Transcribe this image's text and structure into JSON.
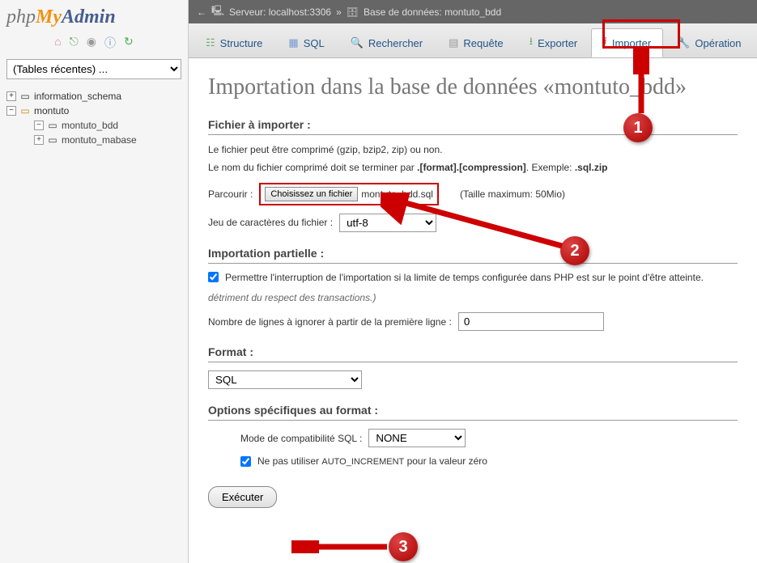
{
  "logo": {
    "php": "php",
    "my": "My",
    "admin": "Admin"
  },
  "sidebar": {
    "recent_label": "(Tables récentes) ...",
    "tree": [
      {
        "label": "information_schema",
        "toggle": "+"
      },
      {
        "label": "montuto",
        "toggle": "−"
      },
      {
        "label": "montuto_bdd",
        "toggle": "−",
        "selected": true
      },
      {
        "label": "montuto_mabase",
        "toggle": "+"
      }
    ]
  },
  "breadcrumb": {
    "server_label": "Serveur: localhost:3306",
    "db_label": "Base de données: montuto_bdd",
    "sep": "»"
  },
  "tabs": [
    {
      "label": "Structure"
    },
    {
      "label": "SQL"
    },
    {
      "label": "Rechercher"
    },
    {
      "label": "Requête"
    },
    {
      "label": "Exporter"
    },
    {
      "label": "Importer",
      "active": true
    },
    {
      "label": "Opération"
    }
  ],
  "page": {
    "title": "Importation dans la base de données «montuto_bdd»",
    "section_file": "Fichier à importer :",
    "hint1": "Le fichier peut être comprimé (gzip, bzip2, zip) ou non.",
    "hint2a": "Le nom du fichier comprimé doit se terminer par ",
    "hint2b": ".[format].[compression]",
    "hint2c": ". Exemple: ",
    "hint2d": ".sql.zip",
    "browse_label": "Parcourir :",
    "choose_btn": "Choisissez un fichier",
    "chosen_file": "montuto_bdd.sql",
    "max_size": "(Taille maximum: 50Mio)",
    "charset_label": "Jeu de caractères du fichier :",
    "charset_value": "utf-8",
    "section_partial": "Importation partielle :",
    "partial_check": "Permettre l'interruption de l'importation si la limite de temps configurée dans PHP est sur le point d'être atteinte.",
    "partial_note": "détriment du respect des transactions.)",
    "skip_label": "Nombre de lignes à ignorer à partir de la première ligne :",
    "skip_value": "0",
    "section_format": "Format :",
    "format_value": "SQL",
    "section_opts": "Options spécifiques au format :",
    "compat_label": "Mode de compatibilité SQL :",
    "compat_value": "NONE",
    "noauto_a": "Ne pas utiliser ",
    "noauto_b": "AUTO_INCREMENT",
    "noauto_c": " pour la valeur zéro",
    "exec_btn": "Exécuter"
  },
  "callouts": {
    "one": "1",
    "two": "2",
    "three": "3"
  }
}
